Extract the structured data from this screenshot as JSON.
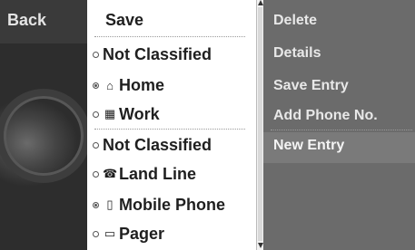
{
  "back": {
    "label": "Back"
  },
  "list": {
    "save_label": "Save",
    "items": [
      {
        "label": "Not Classified",
        "icon": "",
        "selected": false
      },
      {
        "label": "Home",
        "icon": "home-icon",
        "selected": true
      },
      {
        "label": "Work",
        "icon": "work-icon",
        "selected": false
      },
      {
        "label": "Not Classified",
        "icon": "",
        "selected": false
      },
      {
        "label": "Land Line",
        "icon": "phone-icon",
        "selected": false
      },
      {
        "label": "Mobile Phone",
        "icon": "mobile-icon",
        "selected": true
      },
      {
        "label": "Pager",
        "icon": "pager-icon",
        "selected": false
      }
    ]
  },
  "menu": {
    "items": [
      "Delete",
      "Details",
      "Save Entry",
      "Add Phone No.",
      "New Entry"
    ]
  },
  "colors": {
    "panel": "#ffffff",
    "menu_bg": "#6b6b6b",
    "left_bg": "#3a3a3a",
    "text_dark": "#1f1f1f",
    "text_light": "#e8e8e8"
  }
}
